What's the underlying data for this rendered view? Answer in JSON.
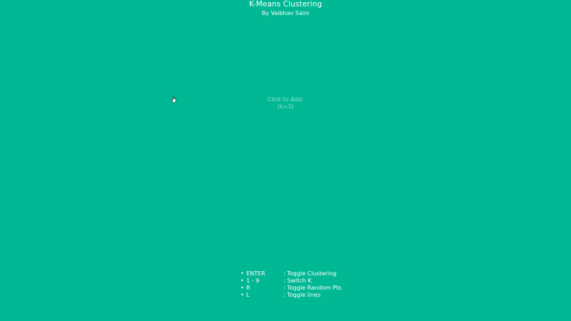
{
  "header": {
    "title": "K-Means Clustering",
    "subtitle": "By Vaibhav Saini"
  },
  "canvas": {
    "hint_line1": "Click to Add:",
    "hint_line2": "(k=3)",
    "cursor_icon": "hand-pointer-icon"
  },
  "controls": [
    {
      "bullet": "•",
      "key": "ENTER",
      "desc": ": Toggle Clustering"
    },
    {
      "bullet": "•",
      "key": "1 - 9",
      "desc": ": Switch K"
    },
    {
      "bullet": "•",
      "key": "R",
      "desc": ": Toggle Random Pts"
    },
    {
      "bullet": "•",
      "key": "L",
      "desc": ": Toggle lines"
    }
  ],
  "colors": {
    "background": "#00b894",
    "text": "#ffffff"
  }
}
